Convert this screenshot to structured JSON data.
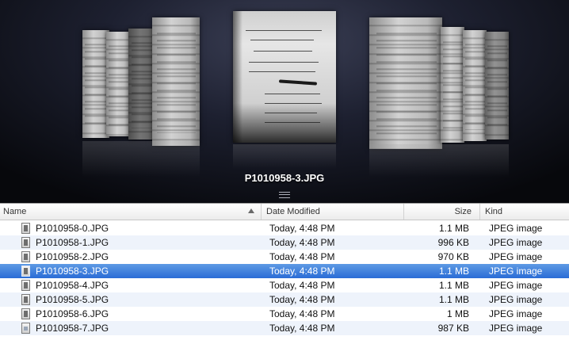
{
  "preview": {
    "caption": "P1010958-3.JPG"
  },
  "columns": {
    "name": "Name",
    "date_modified": "Date Modified",
    "size": "Size",
    "kind": "Kind"
  },
  "files": [
    {
      "name": "P1010958-0.JPG",
      "date": "Today, 4:48 PM",
      "size": "1.1 MB",
      "kind": "JPEG image"
    },
    {
      "name": "P1010958-1.JPG",
      "date": "Today, 4:48 PM",
      "size": "996 KB",
      "kind": "JPEG image"
    },
    {
      "name": "P1010958-2.JPG",
      "date": "Today, 4:48 PM",
      "size": "970 KB",
      "kind": "JPEG image"
    },
    {
      "name": "P1010958-3.JPG",
      "date": "Today, 4:48 PM",
      "size": "1.1 MB",
      "kind": "JPEG image",
      "selected": true
    },
    {
      "name": "P1010958-4.JPG",
      "date": "Today, 4:48 PM",
      "size": "1.1 MB",
      "kind": "JPEG image"
    },
    {
      "name": "P1010958-5.JPG",
      "date": "Today, 4:48 PM",
      "size": "1.1 MB",
      "kind": "JPEG image"
    },
    {
      "name": "P1010958-6.JPG",
      "date": "Today, 4:48 PM",
      "size": "1 MB",
      "kind": "JPEG image"
    },
    {
      "name": "P1010958-7.JPG",
      "date": "Today, 4:48 PM",
      "size": "987 KB",
      "kind": "JPEG image"
    }
  ],
  "colors": {
    "selection": "#2a6cd6",
    "alt_row": "#eef3fb"
  }
}
